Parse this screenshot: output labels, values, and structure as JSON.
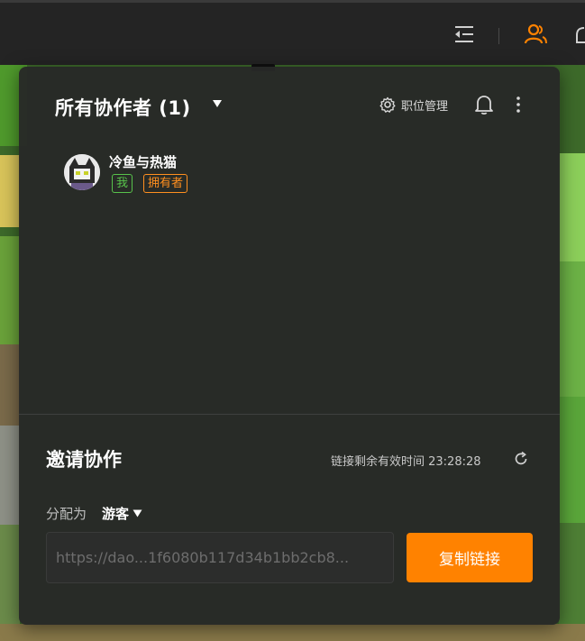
{
  "collaborators": {
    "title": "所有协作者 (1)",
    "role_management_label": "职位管理",
    "members": [
      {
        "name": "冷鱼与热猫",
        "badges": {
          "me": "我",
          "owner": "拥有者"
        }
      }
    ]
  },
  "invite": {
    "title": "邀请协作",
    "expiry_text": "链接剩余有效时间 23:28:28",
    "assign_label": "分配为",
    "assign_role": "游客",
    "link_value": "https://dao...1f6080b117d34b1bb2cb8...",
    "copy_button_label": "复制链接"
  },
  "colors": {
    "accent": "#ff8200",
    "me_badge": "#58c24b",
    "owner_badge": "#ff8f1f",
    "panel_bg": "#282928"
  },
  "icons": {
    "topbar": [
      "collapse-menu-icon",
      "collaborators-icon",
      "partial-icon"
    ],
    "panel": [
      "caret-down-icon",
      "gear-icon",
      "bell-icon",
      "more-vertical-icon",
      "refresh-icon"
    ]
  }
}
